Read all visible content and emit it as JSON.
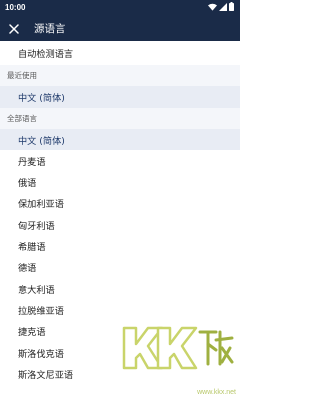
{
  "status_bar": {
    "time": "10:00",
    "icons": [
      "wifi-icon",
      "signal-icon",
      "battery-icon"
    ]
  },
  "toolbar": {
    "close_icon": "close-icon",
    "title": "源语言"
  },
  "auto_detect": "自动检测语言",
  "recent": {
    "header": "最近使用",
    "items": [
      "中文 (简体)"
    ]
  },
  "all": {
    "header": "全部语言",
    "items": [
      "中文 (简体)",
      "丹麦语",
      "俄语",
      "保加利亚语",
      "匈牙利语",
      "希腊语",
      "德语",
      "意大利语",
      "拉脱维亚语",
      "捷克语",
      "斯洛伐克语",
      "斯洛文尼亚语"
    ]
  },
  "colors": {
    "header_bg": "#1a2b48",
    "selected_bg": "#e8ecf4",
    "selected_text": "#1f3a6b",
    "section_bg": "#f4f6fa"
  },
  "watermark": {
    "logo_text": "KK下载",
    "url": "www.kkx.net"
  }
}
